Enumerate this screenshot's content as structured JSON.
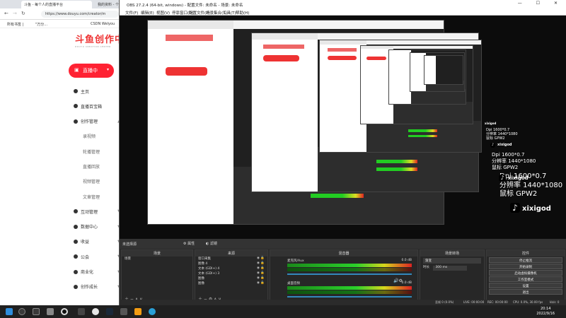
{
  "browser": {
    "tabs": [
      "斗鱼 - 每个人的直播平台",
      "我的资料 - 个人中心",
      "CSDN Welyou"
    ],
    "url": "https://www.douyu.com/creator/m",
    "bookmarks": [
      "所有书签 |",
      "\"万分…",
      "CSDN Welyou"
    ],
    "logo": "斗鱼创作中心",
    "logo_sub": "DOUYU CREATION CENTER",
    "live_button": "直播中",
    "nav": [
      {
        "label": "主页",
        "sub": false
      },
      {
        "label": "直播百宝箱",
        "sub": false
      },
      {
        "label": "创作管理",
        "sub": false,
        "chevron": "▲"
      },
      {
        "label": "录视频",
        "sub": true
      },
      {
        "label": "轮播管理",
        "sub": true
      },
      {
        "label": "直播回放",
        "sub": true
      },
      {
        "label": "视频管理",
        "sub": true
      },
      {
        "label": "文章管理",
        "sub": true
      },
      {
        "label": "互动管理",
        "sub": false,
        "chevron": "▼"
      },
      {
        "label": "数据中心",
        "sub": false,
        "chevron": "▼"
      },
      {
        "label": "收益",
        "sub": false,
        "chevron": "▼"
      },
      {
        "label": "公会",
        "sub": false,
        "chevron": "▼"
      },
      {
        "label": "商业化",
        "sub": false,
        "chevron": "▼"
      },
      {
        "label": "创作成长",
        "sub": false,
        "chevron": "▼"
      }
    ]
  },
  "obs": {
    "title": "OBS 27.2.4 (64-bit, windows) - 配置文件: 未命名 - 场景: 未命名",
    "window_controls": "— ☐ ✕",
    "menu": [
      "文件(F)",
      "编辑(E)",
      "视图(V)",
      "停靠窗口(D)",
      "配置文件(P)",
      "场景集合(S)",
      "工具(T)",
      "帮助(H)"
    ],
    "overlay": {
      "dpi": "Dpi 1600*0.7",
      "resolution": "分辨率 1440*1080",
      "mouse": "鼠标 GPW2",
      "tiktok_id": "xixigod",
      "tiktok_note": "♪"
    },
    "context_bar": {
      "source": "未选择源",
      "properties": "属性",
      "filters": "滤镜"
    },
    "panels": {
      "scenes": {
        "title": "场景",
        "items": [
          "场景"
        ]
      },
      "sources": {
        "title": "来源",
        "items": [
          "窗口采集",
          "图像 4",
          "文本 (GDI+) 4",
          "文本 (GDI+) 3",
          "图像",
          "图像"
        ]
      },
      "mixer": {
        "title": "混音器",
        "tracks": [
          {
            "name": "麦克风/Aux",
            "db": "0.0 dB"
          },
          {
            "name": "桌面音频",
            "db": "0.0 dB"
          }
        ]
      },
      "transitions": {
        "title": "场景转场",
        "type": "渐变",
        "duration_label": "时长",
        "duration": "300 ms"
      },
      "controls": {
        "title": "控件",
        "buttons": [
          "停止推流",
          "开始录制",
          "启动虚拟摄像机",
          "工作室模式",
          "设置",
          "退出"
        ]
      }
    },
    "status": {
      "dropped": "丢帧 0 (0.0%)",
      "live": "LIVE: 00:00:00",
      "rec": "REC: 00:00:00",
      "cpu": "CPU: 0.0%, 30.00 fps",
      "kbps": "kb/s: 0"
    }
  },
  "taskbar": {
    "time": "20:14",
    "date": "2022/9/16"
  }
}
